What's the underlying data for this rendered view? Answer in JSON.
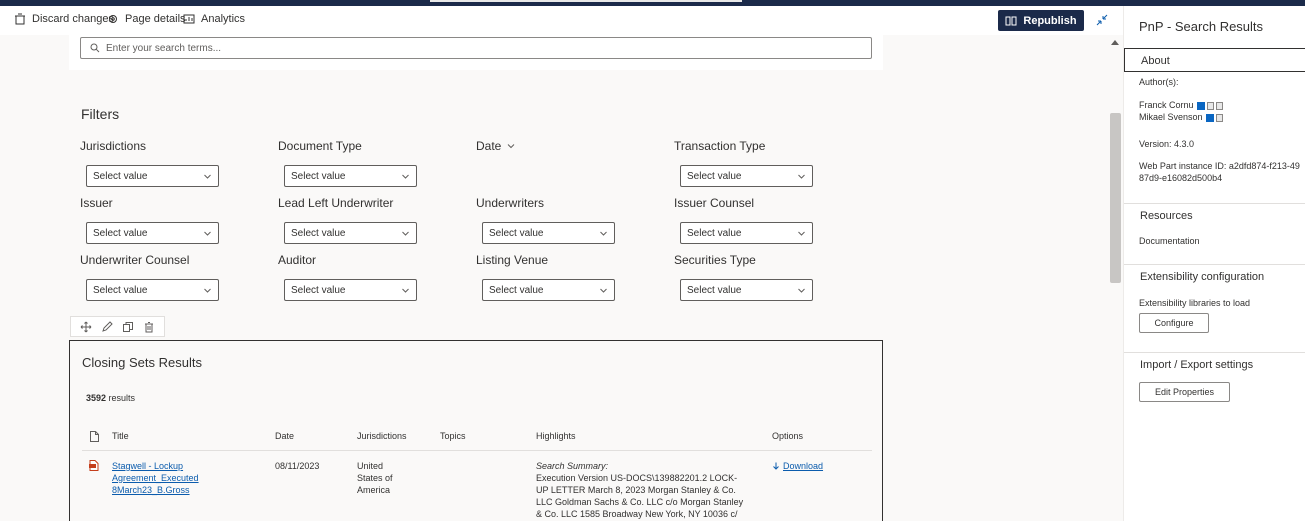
{
  "toolbar": {
    "discard_label": "Discard changes",
    "page_details_label": "Page details",
    "analytics_label": "Analytics",
    "republish_label": "Republish"
  },
  "search": {
    "placeholder": "Enter your search terms..."
  },
  "filters": {
    "title": "Filters",
    "select_placeholder": "Select value",
    "items": [
      {
        "label": "Jurisdictions",
        "value": "Select value"
      },
      {
        "label": "Document Type",
        "value": "Select value"
      },
      {
        "label": "Date",
        "value": ""
      },
      {
        "label": "Transaction Type",
        "value": "Select value"
      },
      {
        "label": "Issuer",
        "value": "Select value"
      },
      {
        "label": "Lead Left Underwriter",
        "value": "Select value"
      },
      {
        "label": "Underwriters",
        "value": "Select value"
      },
      {
        "label": "Issuer Counsel",
        "value": "Select value"
      },
      {
        "label": "Underwriter Counsel",
        "value": "Select value"
      },
      {
        "label": "Auditor",
        "value": "Select value"
      },
      {
        "label": "Listing Venue",
        "value": "Select value"
      },
      {
        "label": "Securities Type",
        "value": "Select value"
      }
    ]
  },
  "results": {
    "title": "Closing Sets Results",
    "count": "3592",
    "count_suffix": "results",
    "columns": [
      "Title",
      "Date",
      "Jurisdictions",
      "Topics",
      "Highlights",
      "Options"
    ],
    "rows": [
      {
        "title": "Stagwell - Lockup Agreement_Executed 8March23_B.Gross",
        "date": "08/11/2023",
        "jurisdictions": "United States of America",
        "topics": "",
        "highlight_label": "Search Summary:",
        "highlight_text": "Execution Version US-DOCS\\139882201.2 LOCK-UP LETTER March 8, 2023 Morgan Stanley & Co. LLC Goldman Sachs & Co. LLC c/o Morgan Stanley & Co. LLC 1585 Broadway New York, NY 10036 c/",
        "option": "Download"
      }
    ]
  },
  "pane": {
    "title": "PnP - Search Results",
    "about": "About",
    "authors_label": "Author(s):",
    "author1": "Franck Cornu",
    "author2": "Mikael Svenson",
    "version": "Version: 4.3.0",
    "instance_id_line1": "Web Part instance ID: a2dfd874-f213-49",
    "instance_id_line2": "87d9-e16082d500b4",
    "resources": "Resources",
    "documentation": "Documentation",
    "extensibility": "Extensibility configuration",
    "ext_libraries": "Extensibility libraries to load",
    "configure": "Configure",
    "import_export": "Import / Export settings",
    "edit_properties": "Edit Properties"
  },
  "colors": {
    "brand_dark": "#1b2a4a",
    "link": "#0b5cad"
  }
}
